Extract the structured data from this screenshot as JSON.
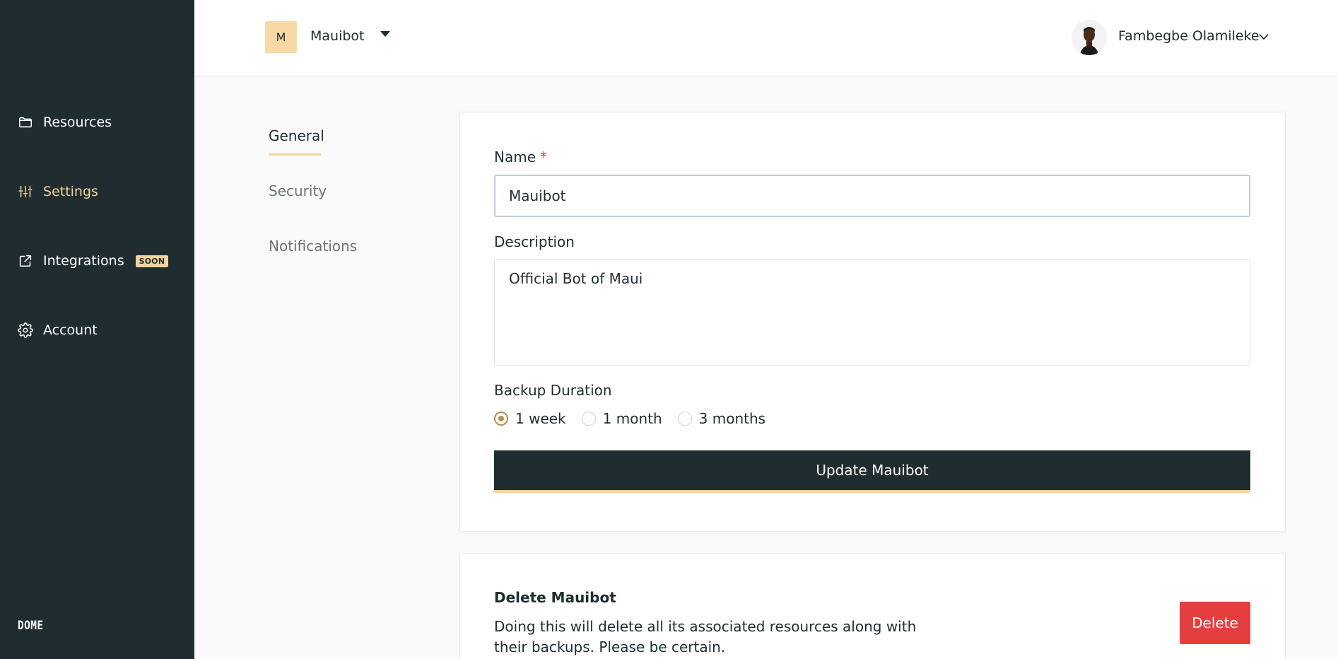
{
  "sidebar": {
    "items": [
      {
        "label": "Resources",
        "icon": "folder-icon"
      },
      {
        "label": "Settings",
        "icon": "sliders-icon",
        "active": true
      },
      {
        "label": "Integrations",
        "icon": "external-link-icon",
        "badge": "SOON"
      },
      {
        "label": "Account",
        "icon": "gear-icon"
      }
    ],
    "brand": "DOME"
  },
  "header": {
    "org_initial": "M",
    "org_name": "Mauibot",
    "user_name": "Fambegbe Olamileke"
  },
  "tabs": [
    {
      "label": "General",
      "active": true
    },
    {
      "label": "Security"
    },
    {
      "label": "Notifications"
    }
  ],
  "form": {
    "name_label": "Name",
    "required_mark": "*",
    "name_value": "Mauibot",
    "description_label": "Description",
    "description_value": "Official Bot of Maui",
    "backup_label": "Backup Duration",
    "backup_options": [
      "1 week",
      "1 month",
      "3 months"
    ],
    "backup_selected": "1 week",
    "update_label": "Update Mauibot"
  },
  "danger": {
    "title": "Delete Mauibot",
    "text": "Doing this will delete all its associated resources along with their backups. Please be certain.",
    "delete_label": "Delete"
  },
  "colors": {
    "sidebar_bg": "#1f2d30",
    "accent": "#f6d29d",
    "danger": "#e53e3e",
    "radio_checked": "#b88d4e"
  }
}
